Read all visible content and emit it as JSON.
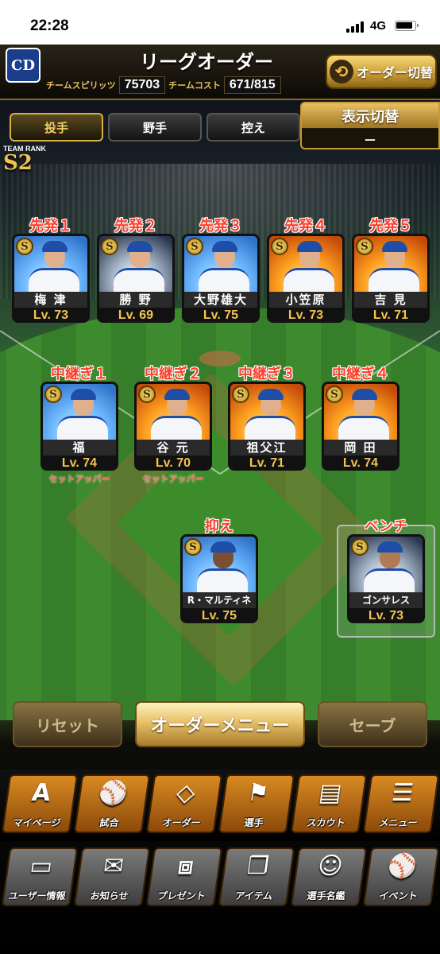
{
  "status": {
    "time": "22:28",
    "network": "4G"
  },
  "header": {
    "title": "リーグオーダー",
    "team_logo": "CD",
    "spirit_label": "チームスピリッツ",
    "spirit_value": "75703",
    "cost_label": "チームコスト",
    "cost_value": "671/815",
    "order_switch_label": "オーダー切替"
  },
  "tabs": [
    {
      "label": "投手"
    },
    {
      "label": "野手"
    },
    {
      "label": "控え"
    }
  ],
  "display_toggle": {
    "label": "表示切替",
    "value": "－"
  },
  "team_rank": {
    "label": "TEAM RANK",
    "value": "S2"
  },
  "starters": [
    {
      "role": "先発１",
      "name": "梅 津",
      "level": "Lv. 73",
      "badge": "S"
    },
    {
      "role": "先発２",
      "name": "勝 野",
      "level": "Lv. 69",
      "badge": "S"
    },
    {
      "role": "先発３",
      "name": "大野雄大",
      "level": "Lv. 75",
      "badge": "S"
    },
    {
      "role": "先発４",
      "name": "小笠原",
      "level": "Lv. 73",
      "badge": "S"
    },
    {
      "role": "先発５",
      "name": "吉 見",
      "level": "Lv. 71",
      "badge": "S"
    }
  ],
  "middle": [
    {
      "role": "中継ぎ１",
      "name": "福",
      "level": "Lv. 74",
      "badge": "S",
      "sub": "セットアッパー"
    },
    {
      "role": "中継ぎ２",
      "name": "谷 元",
      "level": "Lv. 70",
      "badge": "S",
      "sub": "セットアッパー"
    },
    {
      "role": "中継ぎ３",
      "name": "祖父江",
      "level": "Lv. 71",
      "badge": "S",
      "sub": ""
    },
    {
      "role": "中継ぎ４",
      "name": "岡 田",
      "level": "Lv. 74",
      "badge": "S",
      "sub": ""
    }
  ],
  "closer": {
    "role": "抑え",
    "name": "R・マルティネス",
    "level": "Lv. 75",
    "badge": "S"
  },
  "bench": {
    "role": "ベンチ",
    "name": "ゴンサレス",
    "level": "Lv. 73",
    "badge": "S"
  },
  "actions": {
    "reset": "リセット",
    "order_menu": "オーダーメニュー",
    "save": "セーブ"
  },
  "nav_row1": [
    {
      "label": "マイページ",
      "icon": "A"
    },
    {
      "label": "試合",
      "icon": "⚾"
    },
    {
      "label": "オーダー",
      "icon": "◇"
    },
    {
      "label": "選手",
      "icon": "⚑"
    },
    {
      "label": "スカウト",
      "icon": "▤"
    },
    {
      "label": "メニュー",
      "icon": "☰"
    }
  ],
  "nav_row2": [
    {
      "label": "ユーザー情報",
      "icon": "▭"
    },
    {
      "label": "お知らせ",
      "icon": "✉"
    },
    {
      "label": "プレゼント",
      "icon": "⧈"
    },
    {
      "label": "アイテム",
      "icon": "❐"
    },
    {
      "label": "選手名鑑",
      "icon": "☺"
    },
    {
      "label": "イベント",
      "icon": "⚾"
    }
  ]
}
